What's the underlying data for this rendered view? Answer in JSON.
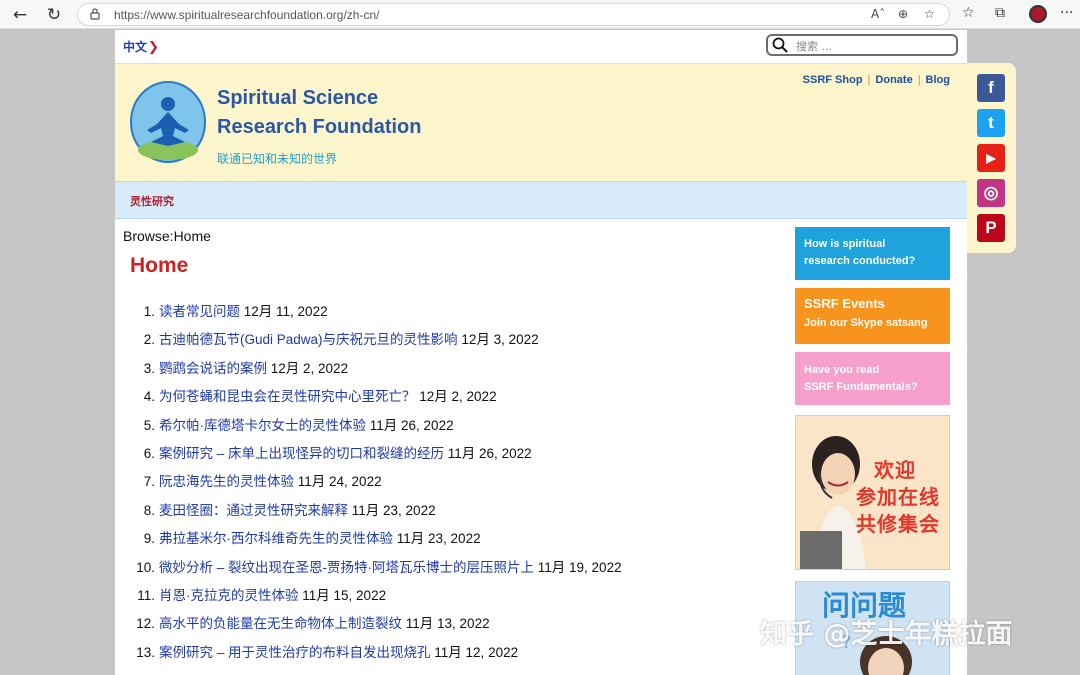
{
  "browser": {
    "url": "https://www.spiritualresearchfoundation.org/zh-cn/",
    "read_aloud_label": "Aˆ"
  },
  "site": {
    "lang_label": "中文",
    "search_placeholder": "搜索 ...",
    "org_line1": "Spiritual Science",
    "org_line2": "Research Foundation",
    "tagline": "联通已知和未知的世界",
    "top_links": [
      "SSRF Shop",
      "Donate",
      "Blog"
    ],
    "menu_item": "灵性研究"
  },
  "main": {
    "breadcrumb": "Browse:Home",
    "title": "Home",
    "articles": [
      {
        "n": "1.",
        "title": "读者常见问题",
        "date": "12月 11, 2022"
      },
      {
        "n": "2.",
        "title": "古迪帕德瓦节(Gudi Padwa)与庆祝元旦的灵性影响",
        "date": "12月 3, 2022"
      },
      {
        "n": "3.",
        "title": "鹦鹉会说话的案例",
        "date": "12月 2, 2022"
      },
      {
        "n": "4.",
        "title": "为何苍蝇和昆虫会在灵性研究中心里死亡？",
        "date": "12月 2, 2022"
      },
      {
        "n": "5.",
        "title": "希尔帕·库德塔卡尔女士的灵性体验",
        "date": "11月 26, 2022"
      },
      {
        "n": "6.",
        "title": "案例研究 – 床单上出现怪异的切口和裂缝的经历",
        "date": "11月 26, 2022"
      },
      {
        "n": "7.",
        "title": "阮忠海先生的灵性体验",
        "date": "11月 24, 2022"
      },
      {
        "n": "8.",
        "title": "麦田怪圈：通过灵性研究来解释",
        "date": "11月 23, 2022"
      },
      {
        "n": "9.",
        "title": "弗拉基米尔·西尔科维奇先生的灵性体验",
        "date": "11月 23, 2022"
      },
      {
        "n": "10.",
        "title": "微妙分析 – 裂纹出现在圣恩-贾扬特·阿塔瓦乐博士的层压照片上",
        "date": "11月 19, 2022"
      },
      {
        "n": "11.",
        "title": "肖恩·克拉克的灵性体验",
        "date": "11月 15, 2022"
      },
      {
        "n": "12.",
        "title": "高水平的负能量在无生命物体上制造裂纹",
        "date": "11月 13, 2022"
      },
      {
        "n": "13.",
        "title": "案例研究 – 用于灵性治疗的布料自发出现烧孔",
        "date": "11月 12, 2022"
      }
    ]
  },
  "sidebar": {
    "box1": {
      "line1": "How is spiritual",
      "line2": "research conducted?"
    },
    "box2": {
      "title": "SSRF Events",
      "subtitle": "Join our Skype satsang"
    },
    "box3": {
      "line1": "Have you read",
      "line2": "SSRF Fundamentals?"
    },
    "box4": {
      "line1": "欢迎",
      "line2": "参加在线",
      "line3": "共修集会"
    },
    "box5": {
      "title": "问问题"
    }
  },
  "social": {
    "facebook": "f",
    "twitter": "t",
    "youtube": "▶",
    "instagram": "◎",
    "pinterest": "P"
  },
  "watermark": "知乎 @芝士年糕拉面",
  "colors": {
    "accent_red": "#d02121",
    "link_blue": "#1f3aa8",
    "header_bg": "#fdf5cb",
    "menu_bg": "#d7ecf8"
  }
}
